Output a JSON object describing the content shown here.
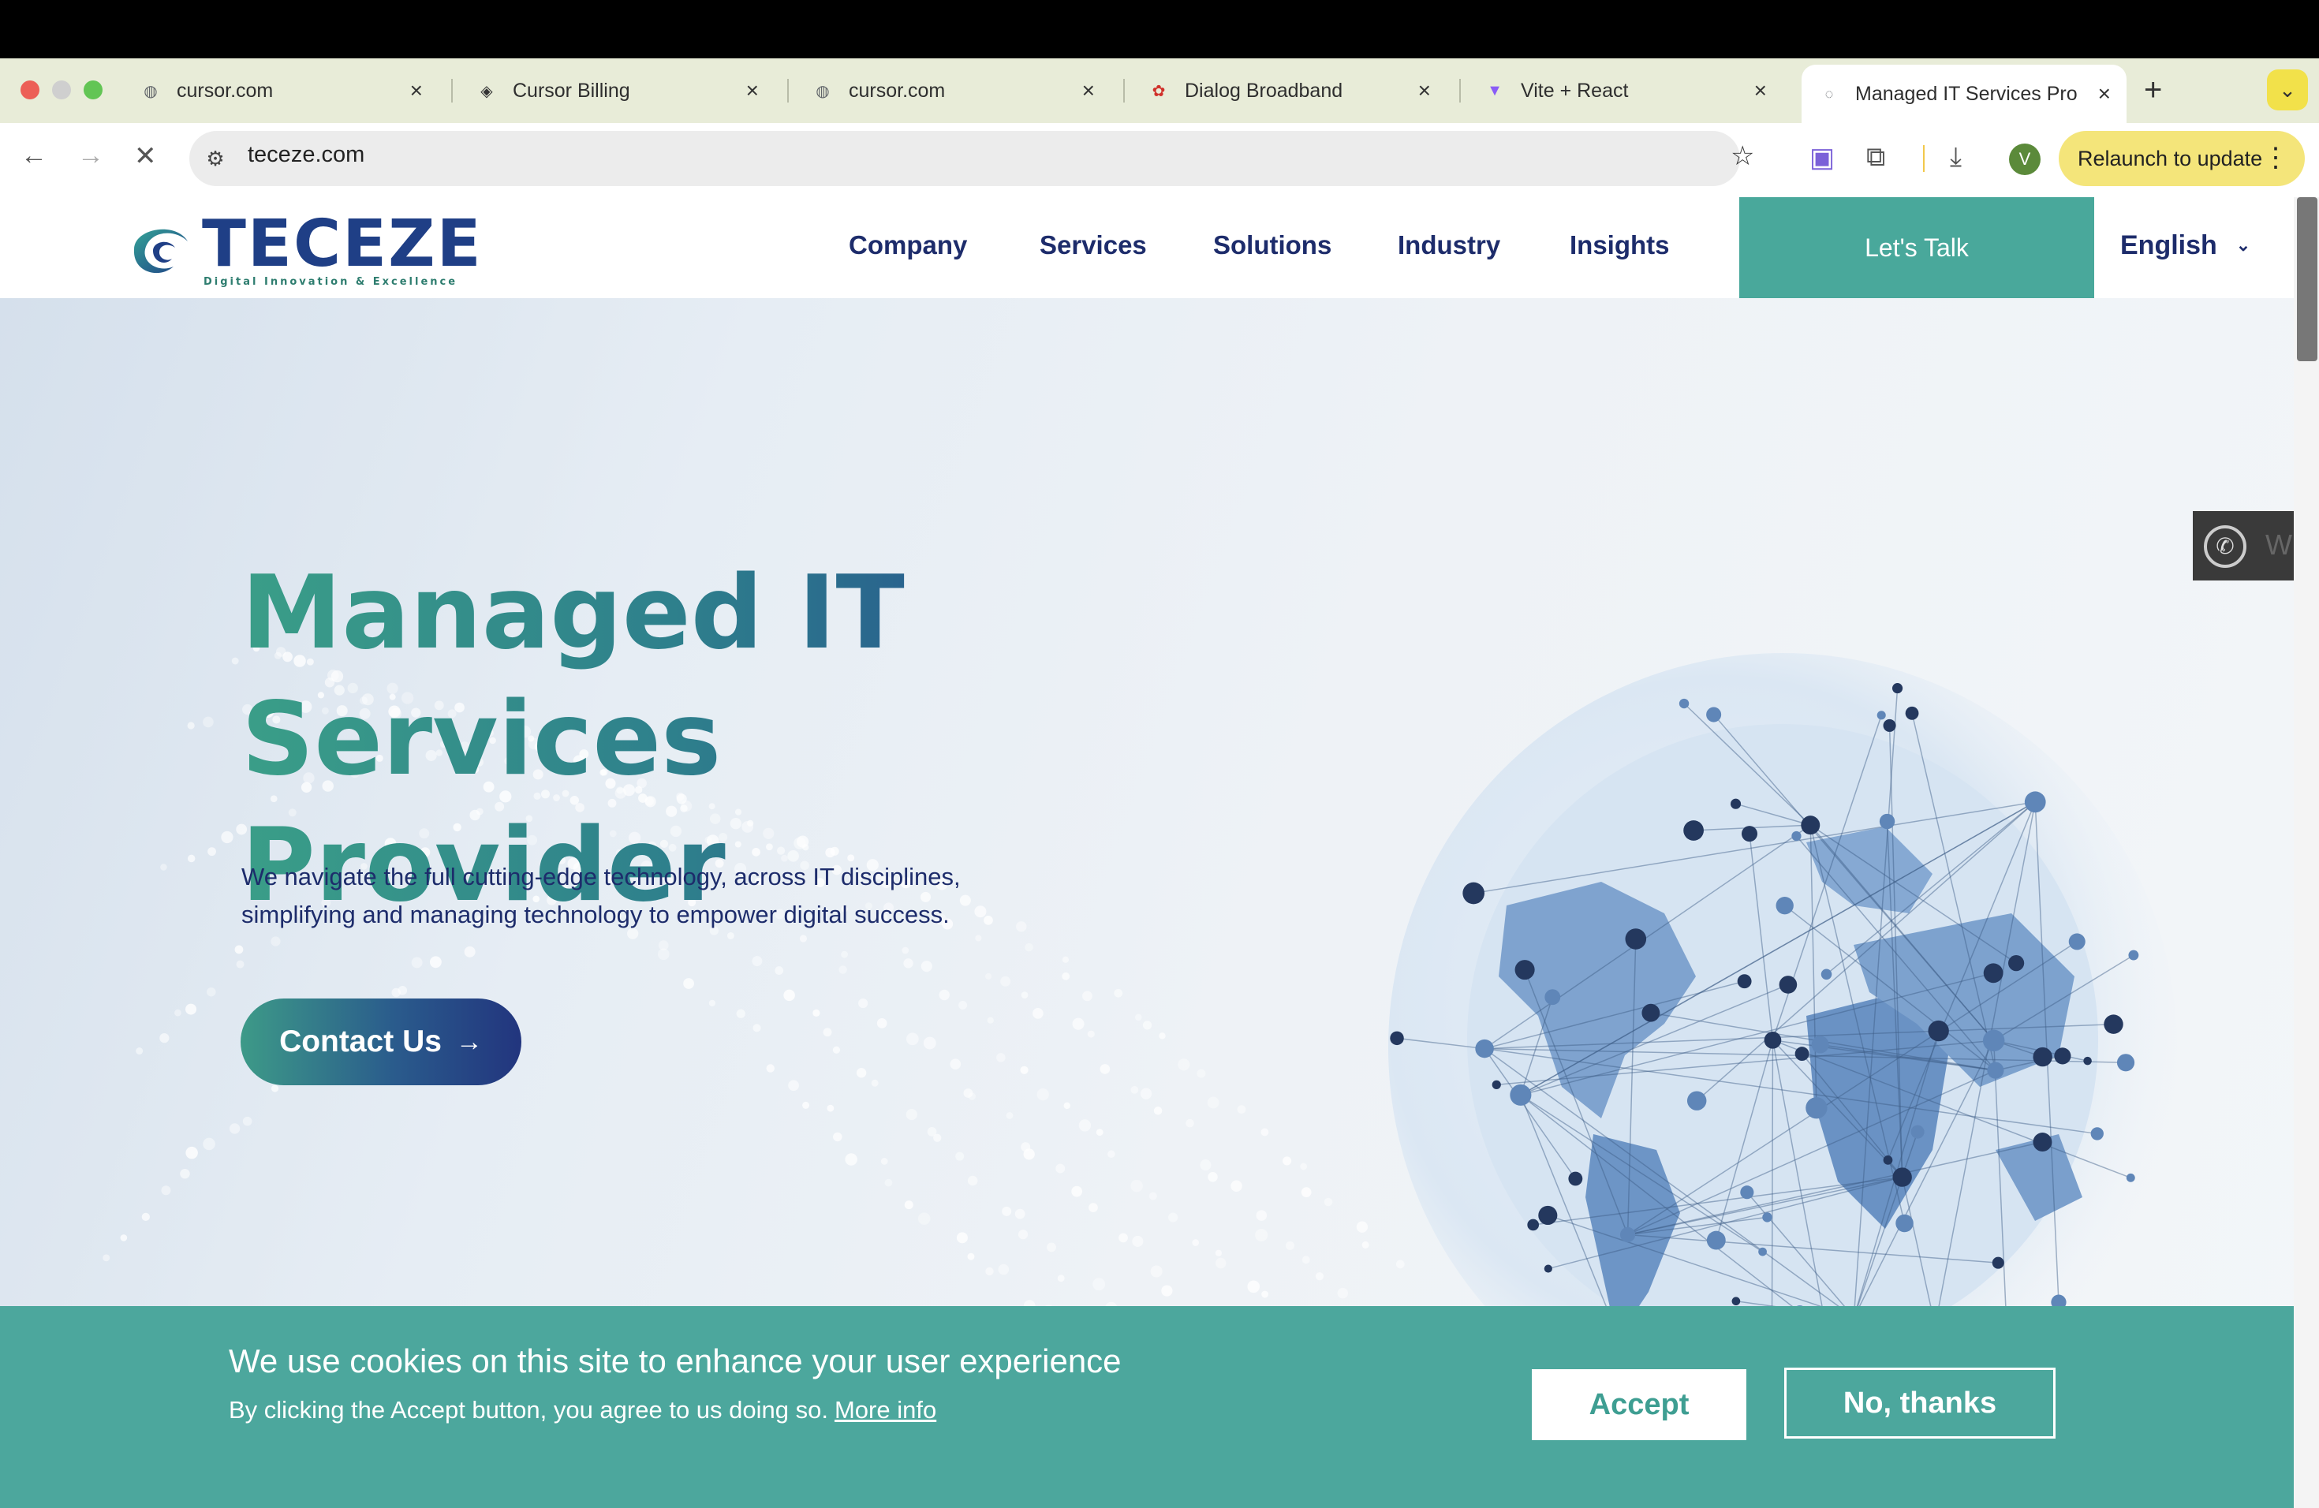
{
  "browser": {
    "tabs": [
      {
        "title": "cursor.com",
        "icon": "globe-icon"
      },
      {
        "title": "Cursor Billing",
        "icon": "cursor-cube-icon"
      },
      {
        "title": "cursor.com",
        "icon": "globe-icon"
      },
      {
        "title": "Dialog Broadband",
        "icon": "huawei-icon"
      },
      {
        "title": "Vite + React",
        "icon": "vite-icon"
      },
      {
        "title": "Managed IT Services Pro",
        "icon": "loading-icon"
      }
    ],
    "new_tab": "+",
    "url": "teceze.com",
    "profile_initial": "V",
    "relaunch_label": "Relaunch to update"
  },
  "site": {
    "logo": {
      "name": "TECEZE",
      "tagline": "Digital Innovation & Excellence"
    },
    "nav": [
      "Company",
      "Services",
      "Solutions",
      "Industry",
      "Insights"
    ],
    "cta": "Let's Talk",
    "language": "English",
    "hero": {
      "title_line1": "Managed IT Services",
      "title_line2": "Provider",
      "subtitle_line1": "We navigate the full cutting-edge technology, across IT disciplines,",
      "subtitle_line2": "simplifying and managing technology to empower digital success.",
      "button": "Contact Us"
    },
    "whatsapp_label": "W",
    "cookie": {
      "title": "We use cookies on this site to enhance your user experience",
      "text": "By clicking the Accept button, you agree to us doing so.",
      "link": "More info",
      "accept": "Accept",
      "decline": "No, thanks"
    }
  },
  "colors": {
    "teal": "#49a89b",
    "navy": "#1d2c6b",
    "cookie_bg": "#4ca79d"
  }
}
